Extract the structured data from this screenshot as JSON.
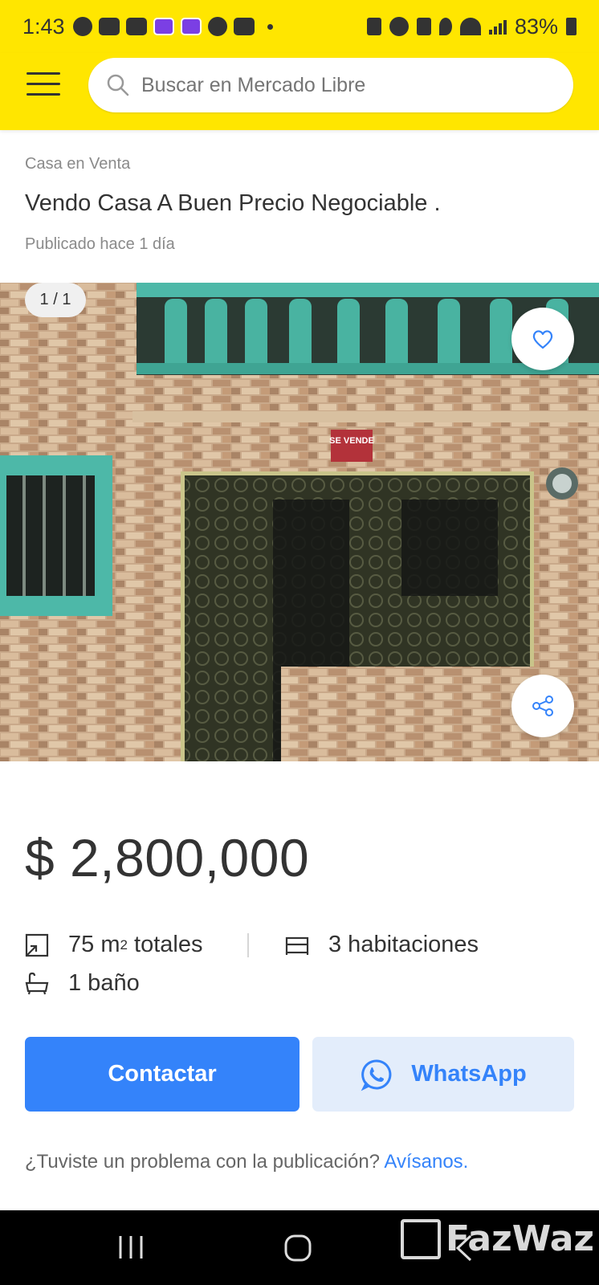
{
  "status_bar": {
    "time": "1:43",
    "battery": "83%",
    "left_icons": [
      "whatsapp-icon",
      "youtube-icon",
      "youtube-icon",
      "app-icon",
      "app-icon",
      "chat-icon",
      "car-icon"
    ],
    "right_icons": [
      "battery-saver-icon",
      "alarm-icon",
      "mute-icon",
      "location-icon",
      "wifi-icon",
      "signal-icon",
      "battery-icon"
    ]
  },
  "header": {
    "menu_icon": "hamburger-icon",
    "search_placeholder": "Buscar en Mercado Libre",
    "accent_color": "#FFE600"
  },
  "listing": {
    "category": "Casa en Venta",
    "title": "Vendo Casa A Buen Precio Negociable .",
    "posted": "Publicado hace 1 día",
    "photo_counter": "1 / 1",
    "photo_sign": "SE VENDE",
    "price": "$ 2,800,000",
    "attributes": {
      "area_value": "75 m",
      "area_sup": "2",
      "area_suffix": " totales",
      "rooms": "3 habitaciones",
      "baths": "1 baño"
    }
  },
  "actions": {
    "contact_label": "Contactar",
    "whatsapp_label": "WhatsApp",
    "primary_color": "#3483FA"
  },
  "report": {
    "question": "¿Tuviste un problema con la publicación? ",
    "link": "Avísanos."
  },
  "watermark": "FazWaz"
}
